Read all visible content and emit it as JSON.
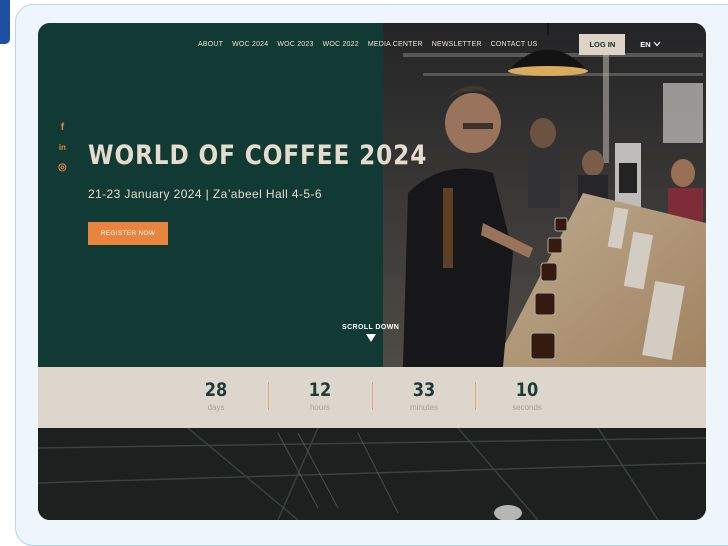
{
  "nav": {
    "items": [
      "ABOUT",
      "WOC 2024",
      "WOC 2023",
      "WOC 2022",
      "MEDIA CENTER",
      "NEWSLETTER",
      "CONTACT US"
    ],
    "login_label": "LOG IN",
    "language": "EN"
  },
  "social": {
    "icons": [
      "facebook-icon",
      "linkedin-icon",
      "instagram-icon"
    ],
    "facebook_glyph": "f",
    "linkedin_glyph": "in",
    "instagram_glyph": "◎"
  },
  "hero": {
    "title": "WORLD OF COFFEE 2024",
    "subtitle": "21-23 January 2024 | Za’abeel Hall 4-5-6",
    "register_label": "REGISTER NOW",
    "scroll_label": "SCROLL DOWN"
  },
  "countdown": {
    "items": [
      {
        "value": "28",
        "label": "days"
      },
      {
        "value": "12",
        "label": "hours"
      },
      {
        "value": "33",
        "label": "minutes"
      },
      {
        "value": "10",
        "label": "seconds"
      }
    ]
  },
  "colors": {
    "dark_green": "#123a34",
    "accent_orange": "#e8843d",
    "cream": "#e6dccd",
    "countdown_bg": "#ddd6cd"
  }
}
